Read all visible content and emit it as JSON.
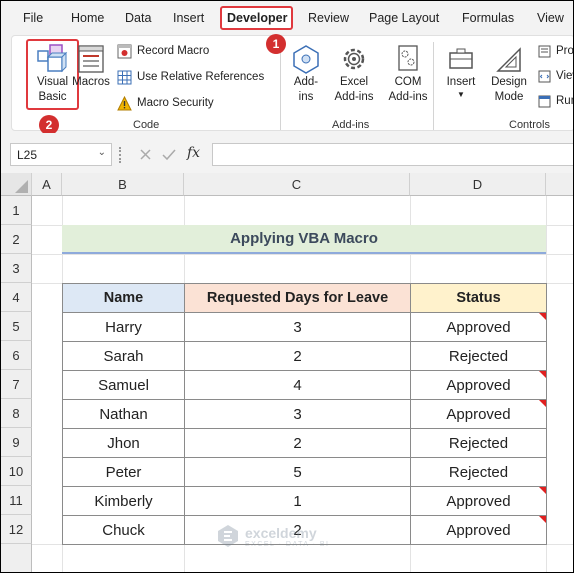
{
  "menu": {
    "tabs": [
      "File",
      "Home",
      "Data",
      "Insert",
      "Developer",
      "Review",
      "Page Layout",
      "Formulas",
      "View"
    ],
    "active_tab": "Developer"
  },
  "badges": {
    "step1": "1",
    "step2": "2"
  },
  "ribbon": {
    "code": {
      "label": "Code",
      "visual_basic": "Visual\nBasic",
      "macros": "Macros",
      "record_macro": "Record Macro",
      "relative_refs": "Use Relative References",
      "macro_security": "Macro Security"
    },
    "addins": {
      "label": "Add-ins",
      "addins": "Add-\nins",
      "excel_addins": "Excel\nAdd-ins",
      "com_addins": "COM\nAdd-ins"
    },
    "controls": {
      "label": "Controls",
      "insert": "Insert",
      "design_mode": "Design\nMode",
      "properties": "Prop",
      "view_code": "View",
      "run_dialog": "Run"
    }
  },
  "formula_bar": {
    "name_box": "L25",
    "fx": "fx",
    "value": ""
  },
  "columns": [
    "A",
    "B",
    "C",
    "D"
  ],
  "rows": [
    "1",
    "2",
    "3",
    "4",
    "5",
    "6",
    "7",
    "8",
    "9",
    "10",
    "11",
    "12"
  ],
  "sheet": {
    "title": "Applying VBA Macro",
    "headers": [
      "Name",
      "Requested Days for Leave",
      "Status"
    ],
    "records": [
      {
        "name": "Harry",
        "days": "3",
        "status": "Approved",
        "comment": true
      },
      {
        "name": "Sarah",
        "days": "2",
        "status": "Rejected",
        "comment": false
      },
      {
        "name": "Samuel",
        "days": "4",
        "status": "Approved",
        "comment": true
      },
      {
        "name": "Nathan",
        "days": "3",
        "status": "Approved",
        "comment": true
      },
      {
        "name": "Jhon",
        "days": "2",
        "status": "Rejected",
        "comment": false
      },
      {
        "name": "Peter",
        "days": "5",
        "status": "Rejected",
        "comment": false
      },
      {
        "name": "Kimberly",
        "days": "1",
        "status": "Approved",
        "comment": true
      },
      {
        "name": "Chuck",
        "days": "2",
        "status": "Approved",
        "comment": true
      }
    ]
  },
  "watermark": {
    "name": "exceldemy",
    "sub": "EXCEL · DATA · BI"
  },
  "colors": {
    "accent_red": "#e0393e",
    "badge_red": "#d32f2f",
    "comment_red": "#e02020",
    "title_fill": "#e2efda"
  }
}
